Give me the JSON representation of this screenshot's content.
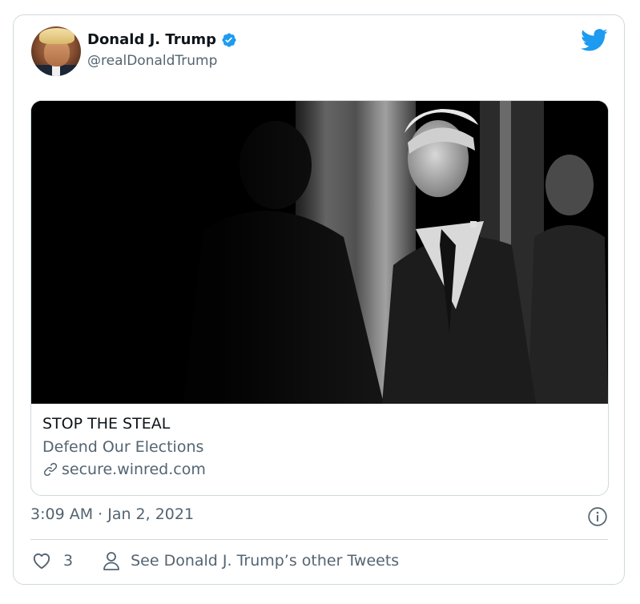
{
  "tweet": {
    "display_name": "Donald J. Trump",
    "handle": "@realDonaldTrump",
    "timestamp": "3:09 AM · Jan 2, 2021",
    "link_card": {
      "title": "STOP THE STEAL",
      "description": "Defend Our Elections",
      "domain": "secure.winred.com"
    },
    "like_count": "3",
    "see_more_label": "See Donald J. Trump’s other Tweets"
  },
  "colors": {
    "brand_blue": "#1d9bf0",
    "text_primary": "#0f1419",
    "text_secondary": "#536471",
    "border": "#cfd9de"
  },
  "icons": [
    "twitter-bird-icon",
    "verified-badge-icon",
    "link-icon",
    "info-icon",
    "heart-icon",
    "person-icon"
  ]
}
